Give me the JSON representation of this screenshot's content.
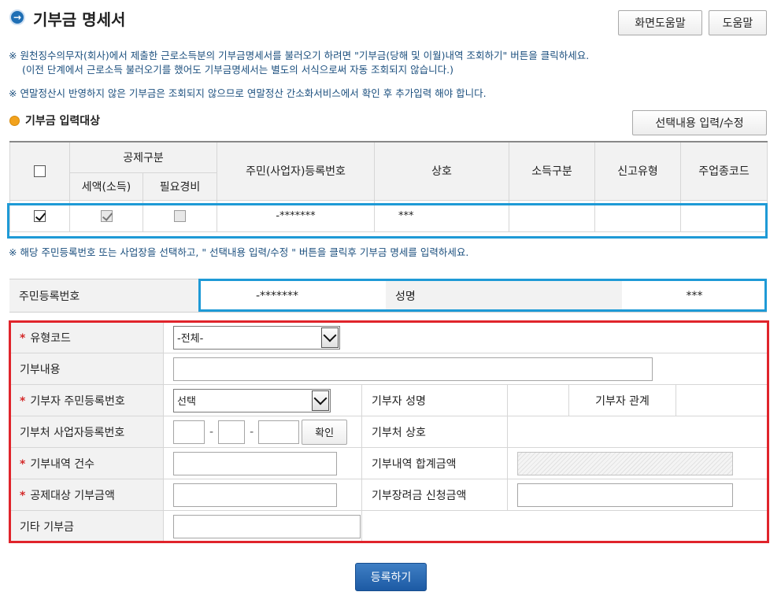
{
  "header": {
    "title": "기부금 명세서",
    "help_screen_label": "화면도움말",
    "help_label": "도움말"
  },
  "notices": {
    "mark": "※",
    "line1": "원천징수의무자(회사)에서 제출한 근로소득분의 기부금명세서를 불러오기 하려면 \"기부금(당해 및 이월)내역 조회하기\" 버튼을 클릭하세요.",
    "line2": "(이전 단계에서 근로소득 불러오기를 했어도 기부금명세서는 별도의 서식으로써 자동 조회되지 않습니다.)",
    "line3": "연말정산시 반영하지 않은 기부금은 조회되지 않으므로 연말정산 간소화서비스에서 확인 후 추가입력 해야 합니다.",
    "line4": "해당 주민등록번호 또는 사업장을 선택하고, \" 선택내용 입력/수정 \"  버튼을 클릭후 기부금 명세를 입력하세요."
  },
  "section": {
    "title": "기부금 입력대상",
    "edit_button": "선택내용 입력/수정"
  },
  "target_table": {
    "headers": {
      "deduction_group": "공제구분",
      "tax_credit": "세액(소득)",
      "necessary_expense": "필요경비",
      "reg_no": "주민(사업자)등록번호",
      "name": "상호",
      "income_type": "소득구분",
      "report_type": "신고유형",
      "business_code": "주업종코드"
    },
    "row": {
      "selected": true,
      "tax_credit_checked": true,
      "necessary_expense_checked": false,
      "reg_no": "-*******",
      "name": "***",
      "income_type": "",
      "report_type": "",
      "business_code": ""
    }
  },
  "person": {
    "reg_no_label": "주민등록번호",
    "reg_no_value": "-*******",
    "name_label": "성명",
    "name_value": "***"
  },
  "form": {
    "type_code_label": "유형코드",
    "type_code_value": "-전체-",
    "content_label": "기부내용",
    "donor_reg_label": "기부자 주민등록번호",
    "donor_reg_value": "선택",
    "donor_name_label": "기부자 성명",
    "donor_relation_label": "기부자 관계",
    "recipient_biz_label": "기부처 사업자등록번호",
    "confirm_label": "확인",
    "recipient_name_label": "기부처 상호",
    "count_label": "기부내역 건수",
    "total_label": "기부내역 합계금액",
    "deduction_amount_label": "공제대상 기부금액",
    "incentive_label": "기부장려금 신청금액",
    "other_label": "기타 기부금",
    "required_mark": "*"
  },
  "submit_label": "등록하기"
}
